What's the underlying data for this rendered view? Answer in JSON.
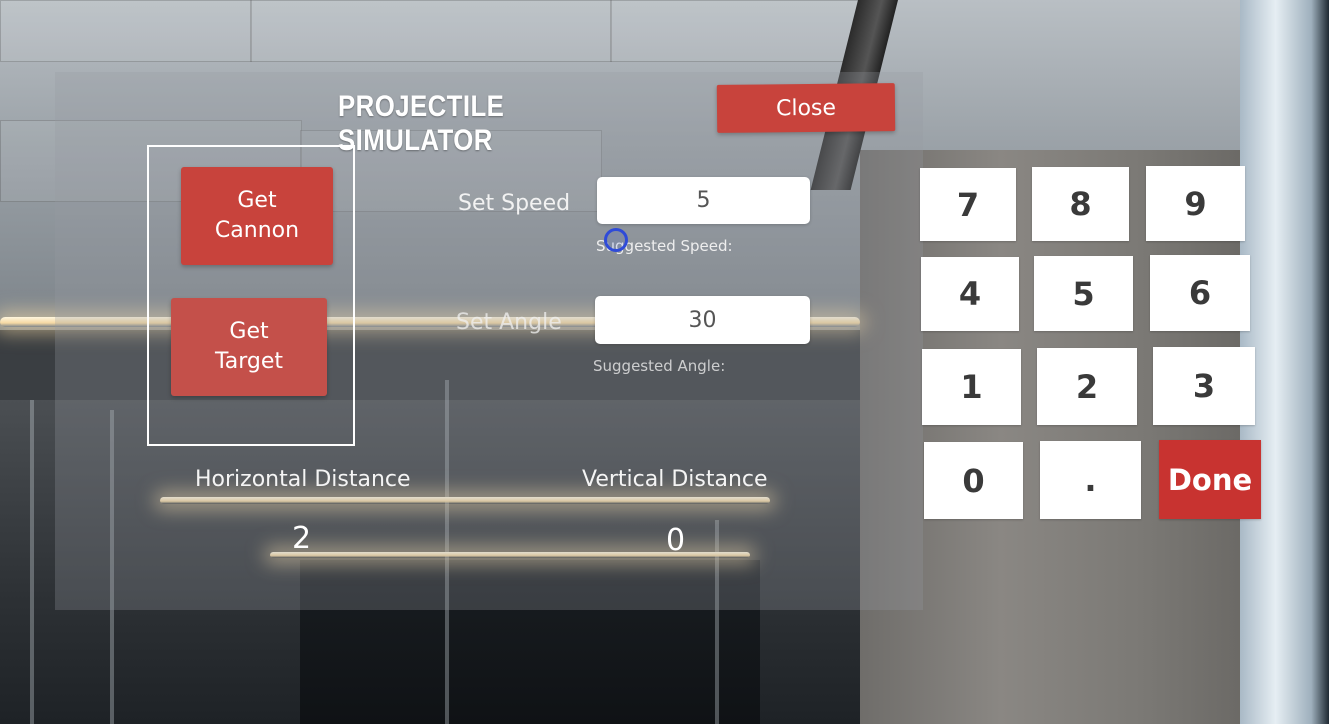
{
  "title": "PROJECTILE SIMULATOR",
  "close_label": "Close",
  "get_cannon_label": "Get\nCannon",
  "get_target_label": "Get\nTarget",
  "speed": {
    "label": "Set Speed",
    "value": "5",
    "suggested_label": "Suggested Speed:"
  },
  "angle": {
    "label": "Set Angle",
    "value": "30",
    "suggested_label": "Suggested Angle:"
  },
  "distances": {
    "horizontal_label": "Horizontal Distance",
    "horizontal_value": "2",
    "vertical_label": "Vertical Distance",
    "vertical_value": "0"
  },
  "keypad": {
    "k7": "7",
    "k8": "8",
    "k9": "9",
    "k4": "4",
    "k5": "5",
    "k6": "6",
    "k1": "1",
    "k2": "2",
    "k3": "3",
    "k0": "0",
    "kdot": ".",
    "done": "Done"
  },
  "colors": {
    "accent_red": "#c8433c",
    "cursor_blue": "#2f4bd8"
  }
}
